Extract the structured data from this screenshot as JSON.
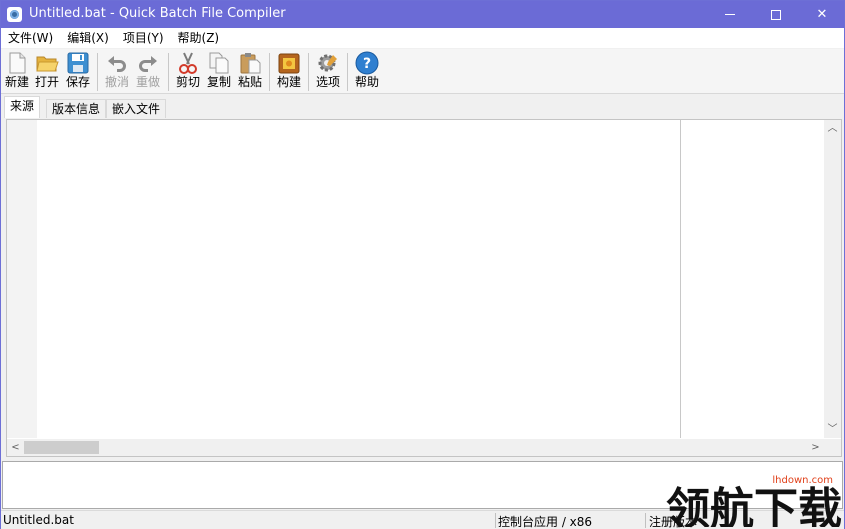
{
  "window": {
    "title": "Untitled.bat - Quick Batch File Compiler",
    "controls": [
      "minimize",
      "maximize",
      "close"
    ]
  },
  "menu": [
    "文件(W)",
    "编辑(X)",
    "项目(Y)",
    "帮助(Z)"
  ],
  "toolbar": {
    "new": "新建",
    "open": "打开",
    "save": "保存",
    "undo": "撤消",
    "redo": "重做",
    "cut": "剪切",
    "copy": "复制",
    "paste": "粘贴",
    "build": "构建",
    "options": "选项",
    "help": "帮助"
  },
  "tabs": [
    "来源",
    "版本信息",
    "嵌入文件"
  ],
  "active_tab": "来源",
  "status": {
    "file": "Untitled.bat",
    "mode": "控制台应用 / x86",
    "edition": "注册版本"
  },
  "watermark": {
    "url": "lhdown.com",
    "text": "领航下载"
  }
}
